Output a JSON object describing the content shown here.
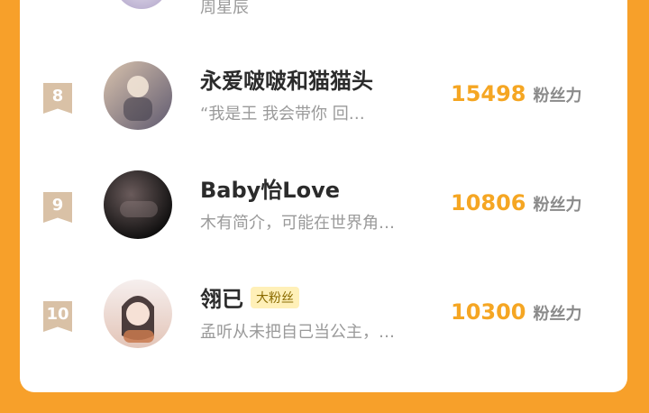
{
  "partial_row": {
    "bio_preview": "周星辰"
  },
  "rows": [
    {
      "rank": "8",
      "name": "永爱啵啵和猫猫头",
      "tag": "",
      "bio": "“我是王 我会带你 回…",
      "score": "15498",
      "score_unit": "粉丝力",
      "avatar_colors": [
        "#c5a58b",
        "#6f6a78"
      ]
    },
    {
      "rank": "9",
      "name": "Baby怡Love",
      "tag": "",
      "bio": "木有简介，可能在世界角…",
      "score": "10806",
      "score_unit": "粉丝力",
      "avatar_colors": [
        "#3a2f2f",
        "#0f0f0f"
      ]
    },
    {
      "rank": "10",
      "name": "翎已",
      "tag": "大粉丝",
      "bio": "孟听从未把自己当公主，…",
      "score": "10300",
      "score_unit": "粉丝力",
      "avatar_colors": [
        "#f3e7e6",
        "#d39a7c"
      ]
    }
  ],
  "theme": {
    "background": "#f7a02a",
    "score_color": "#f5a623",
    "rank_badge_color": "#d9c1a6"
  }
}
